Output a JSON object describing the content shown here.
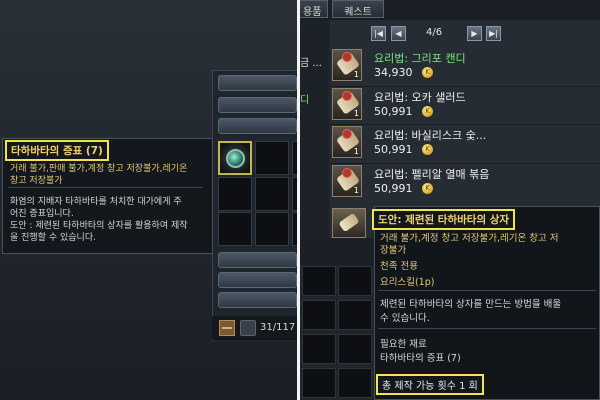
{
  "left_panel": {
    "inventory_count": "31/117",
    "tooltip": {
      "title": "타하바타의 증표 (7)",
      "restriction_lines": [
        "거래 불가,판매 불가,계정 창고 저장불가,레기온",
        "창고 저장불가"
      ],
      "description_lines": [
        "화염의 지배자 타하바타를 처치한 대가에게 주",
        "어진 증표입니다.",
        "도안 : 제련된 타하바타의 상자를 활용하여 제작",
        "을 진행할 수 있습니다."
      ]
    }
  },
  "right_panel": {
    "tabs": {
      "active_partial": "용품",
      "quest": "퀘스트"
    },
    "pager": {
      "text": "4/6",
      "first": "|◀",
      "prev": "◀",
      "next": "▶",
      "last": "▶|"
    },
    "left_column_labels": [
      "금 ...",
      "디"
    ],
    "recipes": [
      {
        "name": "요리법: 그리포 캔디",
        "price": "34,930",
        "qty": "1",
        "highlight": true
      },
      {
        "name": "요리법: 오카 샐러드",
        "price": "50,991",
        "qty": "1",
        "highlight": false
      },
      {
        "name": "요리법: 바실리스크 숯...",
        "price": "50,991",
        "qty": "1",
        "highlight": false
      },
      {
        "name": "요리법: 펠리알 열매 볶음",
        "price": "50,991",
        "qty": "1",
        "highlight": false
      }
    ],
    "tooltip": {
      "title": "도안: 제련된 타하바타의 상자",
      "restriction_lines": [
        "거래 불가,계정 창고 저장불가,레기온 창고 저",
        "장불가"
      ],
      "race": "천족 전용",
      "skill": "요리스킬(1p)",
      "description_lines": [
        "제련된 타하바타의 상자를 만드는 방법을 배울",
        "수 있습니다."
      ],
      "material_label": "필요한 재료",
      "material": "타하바타의 증표 (7)",
      "craft_count": "총 제작 가능 횟수 1 회"
    }
  },
  "colors": {
    "highlight_border": "#f4e34a",
    "gold_text": "#f2d36b",
    "green_text": "#7ee07e"
  }
}
